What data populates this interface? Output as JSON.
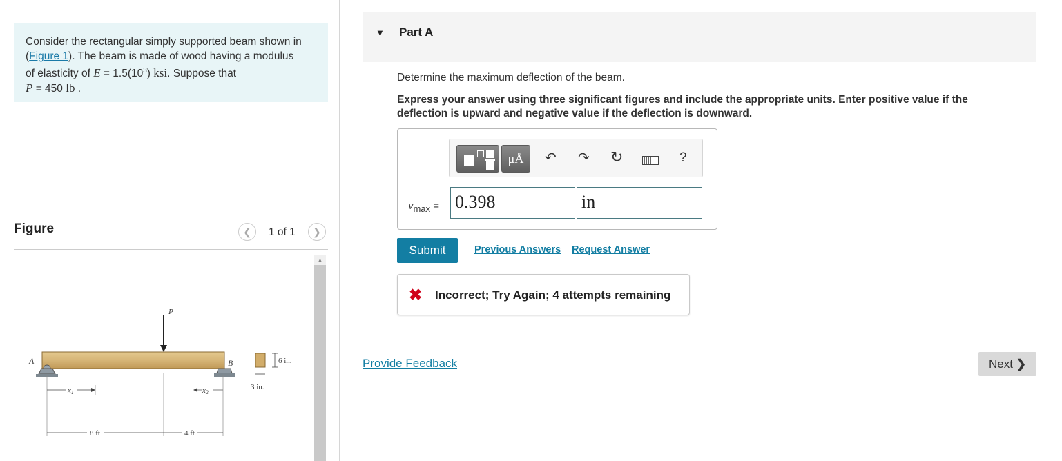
{
  "problem": {
    "line1": "Consider the rectangular simply supported beam shown in",
    "line2_pre": "(",
    "figure_link": "Figure 1",
    "line2_post": "). The beam is made of wood having a modulus",
    "line3_pre": "of elasticity of ",
    "E_symbol": "E",
    "E_value": " = 1.5(10",
    "E_exp": "3",
    "E_close": ") ",
    "E_unit": "ksi",
    "line3_post": ". Suppose that",
    "P_symbol": "P",
    "P_value": " = 450 ",
    "P_unit": "lb",
    "P_end": " ."
  },
  "figure": {
    "label": "Figure",
    "pager": "1 of 1",
    "diagram": {
      "load": "P",
      "support_a": "A",
      "support_b": "B",
      "depth": "6 in.",
      "width": "3 in.",
      "x1": "x",
      "x1_sub": "1",
      "x2": "x",
      "x2_sub": "2",
      "span1": "8 ft",
      "span2": "4 ft"
    }
  },
  "part": {
    "title": "Part A",
    "question": "Determine the maximum deflection of the beam.",
    "instructions": "Express your answer using three significant figures and include the appropriate units. Enter positive value if the deflection is upward and negative value if the deflection is downward."
  },
  "answer": {
    "var": "v",
    "var_sub": "max",
    "equals": " =",
    "value": "0.398",
    "unit": "in",
    "toolbar": {
      "units_label": "μÅ",
      "help_label": "?"
    }
  },
  "actions": {
    "submit": "Submit",
    "previous_answers": "Previous Answers",
    "request_answer": "Request Answer"
  },
  "feedback": {
    "message": "Incorrect; Try Again; 4 attempts remaining"
  },
  "footer": {
    "provide_feedback": "Provide Feedback",
    "next": "Next"
  }
}
